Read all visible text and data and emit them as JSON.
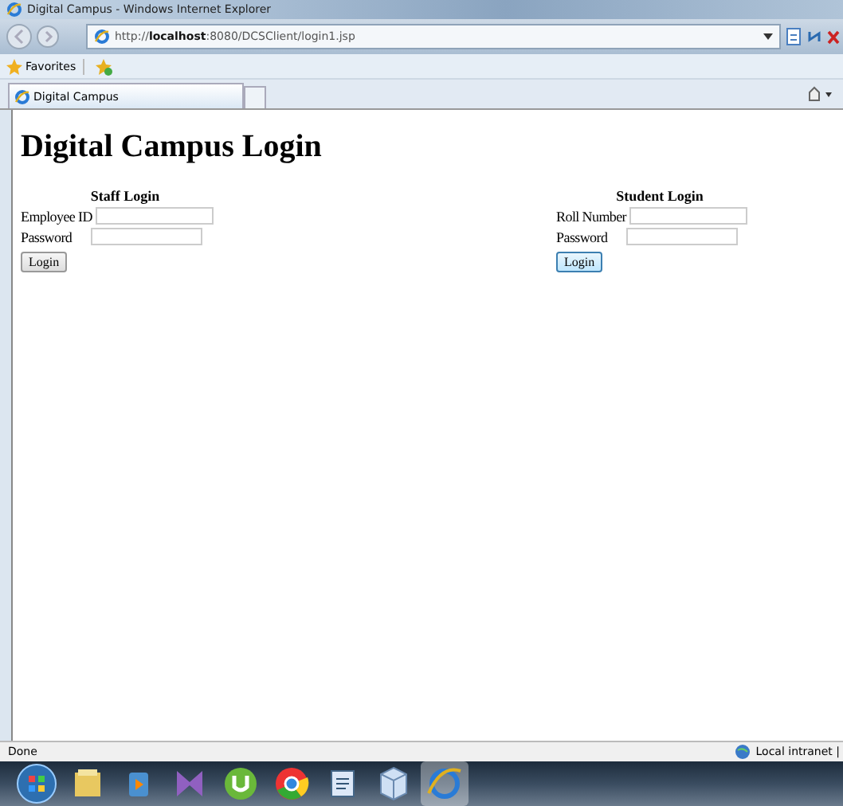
{
  "window": {
    "title": "Digital Campus - Windows Internet Explorer"
  },
  "address_bar": {
    "url_prefix": "http://",
    "url_host": "localhost",
    "url_rest": ":8080/DCSClient/login1.jsp"
  },
  "favorites_bar": {
    "label": "Favorites"
  },
  "tabs": [
    {
      "label": "Digital Campus",
      "selected": true
    }
  ],
  "page": {
    "heading": "Digital Campus Login",
    "forms": [
      {
        "title": "Staff Login",
        "fields": [
          {
            "label": "Employee ID",
            "kind": "text"
          },
          {
            "label": "Password",
            "kind": "password"
          }
        ],
        "button": "Login",
        "focused": false
      },
      {
        "title": "Student Login",
        "fields": [
          {
            "label": "Roll Number",
            "kind": "text"
          },
          {
            "label": "Password",
            "kind": "password"
          }
        ],
        "button": "Login",
        "focused": true
      }
    ]
  },
  "status_bar": {
    "text": "Done",
    "zone": "Local intranet |"
  },
  "taskbar": {
    "items": [
      {
        "kind": "start"
      },
      {
        "kind": "folder"
      },
      {
        "kind": "media"
      },
      {
        "kind": "studio"
      },
      {
        "kind": "torrent"
      },
      {
        "kind": "chrome"
      },
      {
        "kind": "word"
      },
      {
        "kind": "box"
      },
      {
        "kind": "ie",
        "selected": true
      }
    ]
  }
}
